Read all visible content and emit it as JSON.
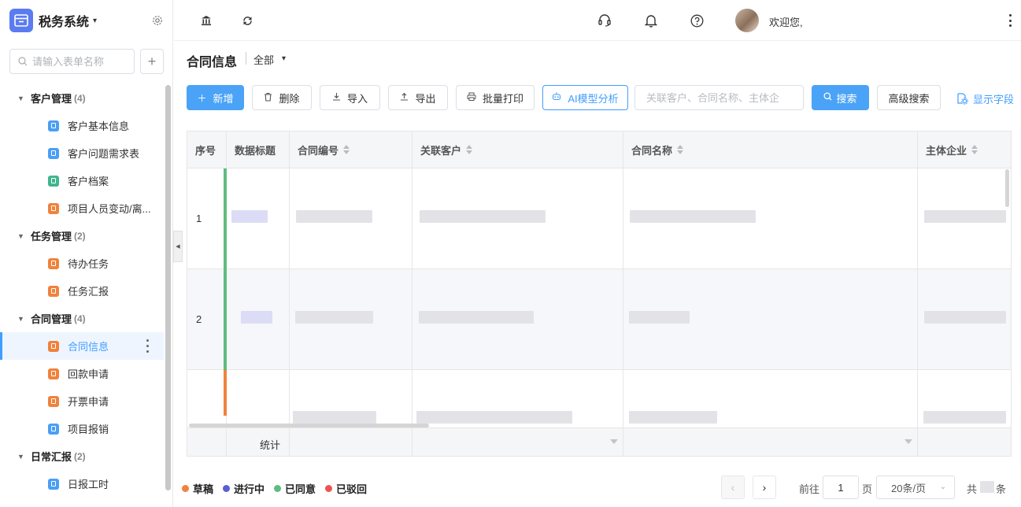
{
  "app": {
    "title": "税务系统",
    "title_caret": "▾"
  },
  "sidebar": {
    "search_placeholder": "请输入表单名称",
    "add_label": "+",
    "groups": [
      {
        "name": "客户管理",
        "count": "(4)",
        "items": [
          "客户基本信息",
          "客户问题需求表",
          "客户档案",
          "项目人员变动/离..."
        ]
      },
      {
        "name": "任务管理",
        "count": "(2)",
        "items": [
          "待办任务",
          "任务汇报"
        ]
      },
      {
        "name": "合同管理",
        "count": "(4)",
        "items": [
          "合同信息",
          "回款申请",
          "开票申请",
          "项目报销"
        ]
      },
      {
        "name": "日常汇报",
        "count": "(2)",
        "items": [
          "日报工时"
        ]
      }
    ],
    "active_item": "合同信息",
    "item_colors": {
      "blue": "#4a9ff5",
      "green": "#3fb68e",
      "orange": "#f0823c"
    }
  },
  "topbar": {
    "welcome": "欢迎您,"
  },
  "page": {
    "title": "合同信息",
    "scope": "全部",
    "scope_caret": "▾"
  },
  "toolbar": {
    "add": "新增",
    "delete": "删除",
    "import": "导入",
    "export": "导出",
    "batch_print": "批量打印",
    "ai_analysis": "AI模型分析",
    "keyword_placeholder": "关联客户、合同名称、主体企",
    "search": "搜索",
    "advanced_search": "高级搜索",
    "show_fields": "显示字段"
  },
  "table": {
    "headers": [
      "序号",
      "数据标题",
      "合同编号",
      "关联客户",
      "合同名称",
      "主体企业"
    ],
    "rows": [
      {
        "index": "1",
        "stripe": "#5ebd7e"
      },
      {
        "index": "2",
        "stripe": "#5ebd7e"
      },
      {
        "index": "",
        "stripe": "#f0823c"
      }
    ],
    "summary_label": "统计"
  },
  "legend": [
    {
      "label": "草稿",
      "color": "#f0823c"
    },
    {
      "label": "进行中",
      "color": "#5a5fd0"
    },
    {
      "label": "已同意",
      "color": "#5ebd7e"
    },
    {
      "label": "已驳回",
      "color": "#ef5350"
    }
  ],
  "pagination": {
    "prev": "‹",
    "next": "›",
    "goto_label": "前往",
    "page_value": "1",
    "page_suffix": "页",
    "page_size": "20条/页",
    "total_prefix": "共",
    "total_suffix": "条"
  },
  "colors": {
    "accent": "#409eff",
    "primary_button": "#4aa3f6"
  }
}
